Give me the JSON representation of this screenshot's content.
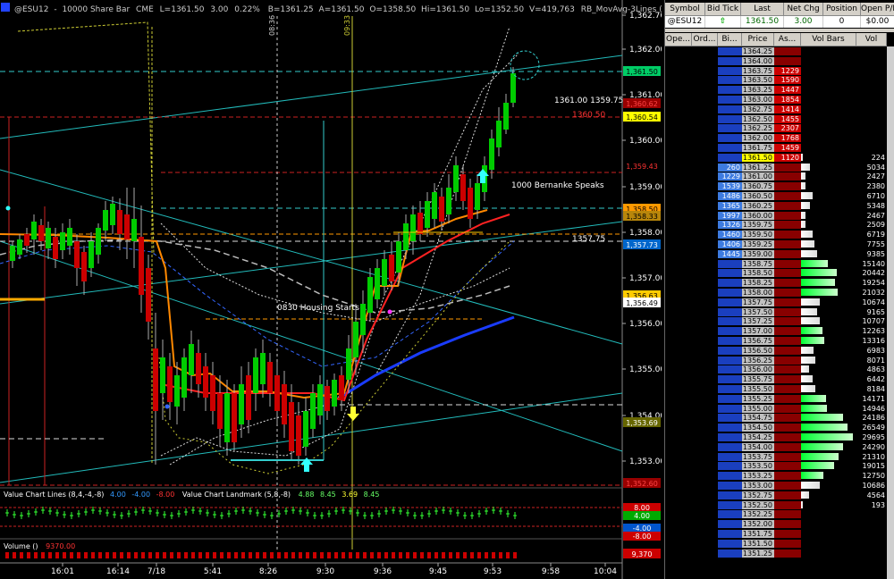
{
  "window": {
    "title_symbol": "@ESU12",
    "title_interval": "10000 Share Bar",
    "exchange": "CME",
    "last": "L=1361.50",
    "change": "3.00",
    "change_pct": "0.22%",
    "bid": "B=1361.25",
    "ask": "A=1361.50",
    "open": "O=1358.50",
    "high": "Hi=1361.50",
    "low": "Lo=1352.50",
    "volume": "V=419,763",
    "indicator_title": "RB_MovAvg-3Lines (Close,10,\"S\",3(..."
  },
  "chart": {
    "price_axis": [
      "1,362.76",
      "1,362.00",
      "1,361.00",
      "1,360.00",
      "1,359.00",
      "1,358.00",
      "1,357.00",
      "1,356.00",
      "1,355.00",
      "1,354.00",
      "1,353.00"
    ],
    "price_tags": [
      {
        "text": "1,361.50",
        "bg": "#00cc66",
        "fg": "#000000"
      },
      {
        "text": "1,360.54",
        "bg": "#ffff00",
        "fg": "#000000"
      },
      {
        "text": "1,360.62",
        "bg": "#990000",
        "fg": "#ff4444"
      },
      {
        "text": "1,359.43",
        "bg": "#000000",
        "fg": "#ff3333"
      },
      {
        "text": "1,358.50",
        "bg": "#ff9900",
        "fg": "#000000"
      },
      {
        "text": "1,358.33",
        "bg": "#b8860b",
        "fg": "#000000"
      },
      {
        "text": "1,357.73",
        "bg": "#0066cc",
        "fg": "#ffffff"
      },
      {
        "text": "1,356.63",
        "bg": "#ffcc00",
        "fg": "#000000"
      },
      {
        "text": "1,356.49",
        "bg": "#ffffff",
        "fg": "#000000"
      },
      {
        "text": "1,353.69",
        "bg": "#666600",
        "fg": "#ffffff"
      },
      {
        "text": "1,352.60",
        "bg": "#990000",
        "fg": "#ff4444"
      }
    ],
    "annotations": {
      "a1": "1361.00  1359.75",
      "a1b": "1360.50",
      "a2": "1000 Bernanke Speaks",
      "a3": "1357.75",
      "a4": "0830 Housing Starts",
      "time_0836": "08:36",
      "time_0933": "09:33"
    },
    "time_axis": [
      "16:01",
      "16:14",
      "7/18",
      "5:41",
      "8:26",
      "9:30",
      "9:36",
      "9:45",
      "9:53",
      "9:58",
      "10:04"
    ],
    "value_chart": {
      "label1": "Value Chart Lines (8,4,-4,-8)",
      "v1": "4.00",
      "v2": "-4.00",
      "v3": "-8.00",
      "label2": "Value Chart Landmark (5,8,-8)",
      "v4": "4.88",
      "v5": "8.45",
      "v6": "3.69",
      "v7": "8.45",
      "tags": [
        "8.00",
        "4.00",
        "-4.00",
        "-8.00"
      ]
    },
    "volume": {
      "label": "Volume ()",
      "value": "9370.00",
      "tag": "9,370"
    },
    "colors": {
      "up": "#00cc00",
      "down": "#cc0000",
      "cyan": "#33cccc",
      "blue": "#1a3cff",
      "orange": "#ff8800"
    }
  },
  "quote": {
    "headers": [
      "Symbol",
      "Bid Tick",
      "Last",
      "Net Chg",
      "Position",
      "Open P/L"
    ],
    "values": [
      "@ESU12",
      "",
      "1361.50",
      "3.00",
      "0",
      "$0.00"
    ]
  },
  "ladder": {
    "headers": [
      "Ope...",
      "Ord...",
      "Bi...",
      "Price",
      "As...",
      "Vol Bars",
      "Vol"
    ],
    "rows": [
      {
        "price": "1364.25",
        "bid": "",
        "ask": "",
        "vol": "",
        "volbar": 0
      },
      {
        "price": "1364.00",
        "bid": "",
        "ask": "",
        "vol": "",
        "volbar": 0
      },
      {
        "price": "1363.75",
        "bid": "",
        "ask": "1229",
        "vol": "",
        "volbar": 0
      },
      {
        "price": "1363.50",
        "bid": "",
        "ask": "1590",
        "vol": "",
        "volbar": 0
      },
      {
        "price": "1363.25",
        "bid": "",
        "ask": "1447",
        "vol": "",
        "volbar": 0
      },
      {
        "price": "1363.00",
        "bid": "",
        "ask": "1854",
        "vol": "",
        "volbar": 0
      },
      {
        "price": "1362.75",
        "bid": "",
        "ask": "1414",
        "vol": "",
        "volbar": 0
      },
      {
        "price": "1362.50",
        "bid": "",
        "ask": "1455",
        "vol": "",
        "volbar": 0
      },
      {
        "price": "1362.25",
        "bid": "",
        "ask": "2307",
        "vol": "",
        "volbar": 0
      },
      {
        "price": "1362.00",
        "bid": "",
        "ask": "1768",
        "vol": "",
        "volbar": 0
      },
      {
        "price": "1361.75",
        "bid": "",
        "ask": "1459",
        "vol": "",
        "volbar": 0
      },
      {
        "price": "1361.50",
        "bid": "",
        "ask": "1120",
        "vol": "224",
        "volbar": 224
      },
      {
        "price": "1361.25",
        "bid": "260",
        "ask": "",
        "vol": "5034",
        "volbar": 5034
      },
      {
        "price": "1361.00",
        "bid": "1229",
        "ask": "",
        "vol": "2427",
        "volbar": 2427
      },
      {
        "price": "1360.75",
        "bid": "1539",
        "ask": "",
        "vol": "2380",
        "volbar": 2380
      },
      {
        "price": "1360.50",
        "bid": "1486",
        "ask": "",
        "vol": "6710",
        "volbar": 6710
      },
      {
        "price": "1360.25",
        "bid": "1365",
        "ask": "",
        "vol": "5348",
        "volbar": 5348
      },
      {
        "price": "1360.00",
        "bid": "1997",
        "ask": "",
        "vol": "2467",
        "volbar": 2467
      },
      {
        "price": "1359.75",
        "bid": "1326",
        "ask": "",
        "vol": "2509",
        "volbar": 2509
      },
      {
        "price": "1359.50",
        "bid": "1460",
        "ask": "",
        "vol": "6719",
        "volbar": 6719
      },
      {
        "price": "1359.25",
        "bid": "1406",
        "ask": "",
        "vol": "7755",
        "volbar": 7755
      },
      {
        "price": "1359.00",
        "bid": "1445",
        "ask": "",
        "vol": "9385",
        "volbar": 9385
      },
      {
        "price": "1358.75",
        "bid": "",
        "ask": "",
        "vol": "15140",
        "volbar": 15140
      },
      {
        "price": "1358.50",
        "bid": "",
        "ask": "",
        "vol": "20442",
        "volbar": 20442
      },
      {
        "price": "1358.25",
        "bid": "",
        "ask": "",
        "vol": "19254",
        "volbar": 19254
      },
      {
        "price": "1358.00",
        "bid": "",
        "ask": "",
        "vol": "21032",
        "volbar": 21032
      },
      {
        "price": "1357.75",
        "bid": "",
        "ask": "",
        "vol": "10674",
        "volbar": 10674
      },
      {
        "price": "1357.50",
        "bid": "",
        "ask": "",
        "vol": "9165",
        "volbar": 9165
      },
      {
        "price": "1357.25",
        "bid": "",
        "ask": "",
        "vol": "10707",
        "volbar": 10707
      },
      {
        "price": "1357.00",
        "bid": "",
        "ask": "",
        "vol": "12263",
        "volbar": 12263
      },
      {
        "price": "1356.75",
        "bid": "",
        "ask": "",
        "vol": "13316",
        "volbar": 13316
      },
      {
        "price": "1356.50",
        "bid": "",
        "ask": "",
        "vol": "6983",
        "volbar": 6983
      },
      {
        "price": "1356.25",
        "bid": "",
        "ask": "",
        "vol": "8071",
        "volbar": 8071
      },
      {
        "price": "1356.00",
        "bid": "",
        "ask": "",
        "vol": "4863",
        "volbar": 4863
      },
      {
        "price": "1355.75",
        "bid": "",
        "ask": "",
        "vol": "6442",
        "volbar": 6442
      },
      {
        "price": "1355.50",
        "bid": "",
        "ask": "",
        "vol": "8184",
        "volbar": 8184
      },
      {
        "price": "1355.25",
        "bid": "",
        "ask": "",
        "vol": "14171",
        "volbar": 14171
      },
      {
        "price": "1355.00",
        "bid": "",
        "ask": "",
        "vol": "14946",
        "volbar": 14946
      },
      {
        "price": "1354.75",
        "bid": "",
        "ask": "",
        "vol": "24186",
        "volbar": 24186
      },
      {
        "price": "1354.50",
        "bid": "",
        "ask": "",
        "vol": "26549",
        "volbar": 26549
      },
      {
        "price": "1354.25",
        "bid": "",
        "ask": "",
        "vol": "29695",
        "volbar": 29695
      },
      {
        "price": "1354.00",
        "bid": "",
        "ask": "",
        "vol": "24290",
        "volbar": 24290
      },
      {
        "price": "1353.75",
        "bid": "",
        "ask": "",
        "vol": "21310",
        "volbar": 21310
      },
      {
        "price": "1353.50",
        "bid": "",
        "ask": "",
        "vol": "19015",
        "volbar": 19015
      },
      {
        "price": "1353.25",
        "bid": "",
        "ask": "",
        "vol": "12750",
        "volbar": 12750
      },
      {
        "price": "1353.00",
        "bid": "",
        "ask": "",
        "vol": "10686",
        "volbar": 10686
      },
      {
        "price": "1352.75",
        "bid": "",
        "ask": "",
        "vol": "4564",
        "volbar": 4564
      },
      {
        "price": "1352.50",
        "bid": "",
        "ask": "",
        "vol": "193",
        "volbar": 193
      },
      {
        "price": "1352.25",
        "bid": "",
        "ask": "",
        "vol": "",
        "volbar": 0
      },
      {
        "price": "1352.00",
        "bid": "",
        "ask": "",
        "vol": "",
        "volbar": 0
      },
      {
        "price": "1351.75",
        "bid": "",
        "ask": "",
        "vol": "",
        "volbar": 0
      },
      {
        "price": "1351.50",
        "bid": "",
        "ask": "",
        "vol": "",
        "volbar": 0
      },
      {
        "price": "1351.25",
        "bid": "",
        "ask": "",
        "vol": "",
        "volbar": 0
      }
    ],
    "last_price": "1361.50"
  }
}
